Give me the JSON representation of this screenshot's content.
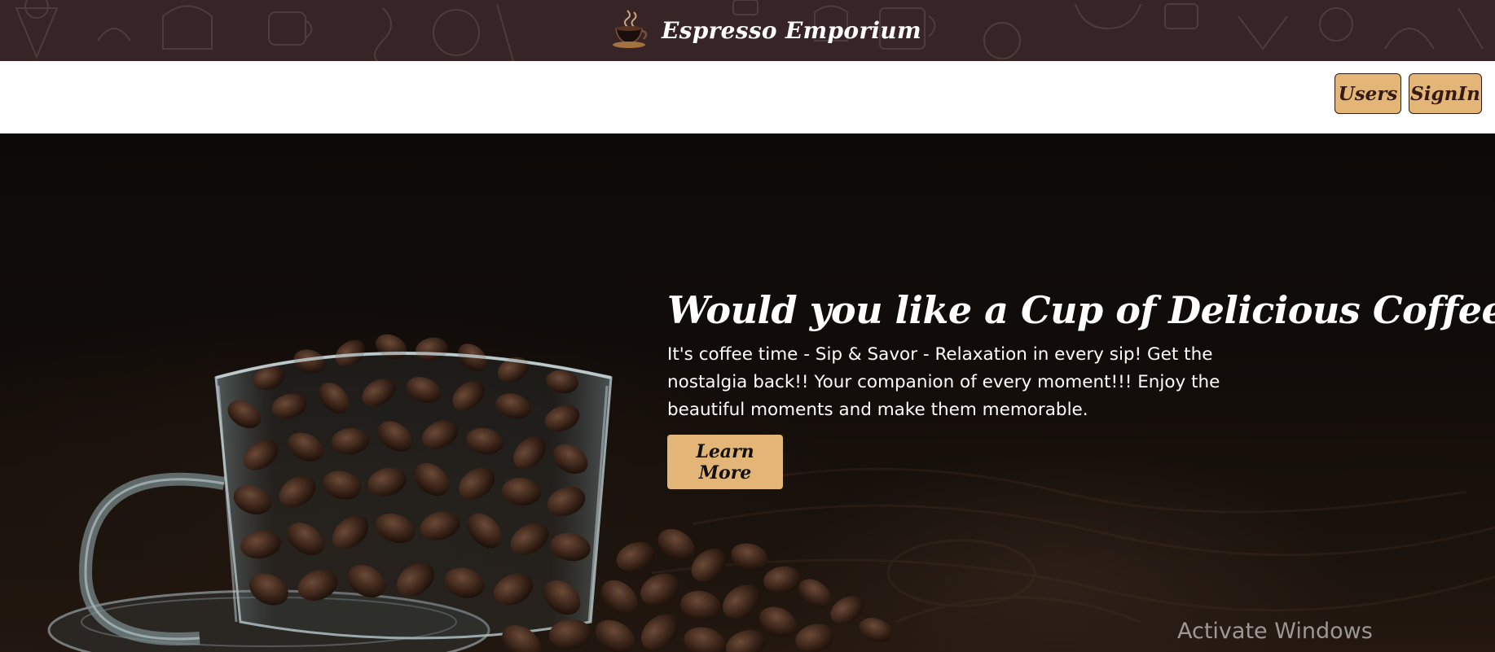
{
  "header": {
    "brand_title": "Espresso Emporium",
    "logo_icon": "coffee-cup-logo-icon",
    "background_color": "#372427"
  },
  "nav": {
    "users_label": "Users",
    "signin_label": "SignIn",
    "button_color": "#e3b577"
  },
  "hero": {
    "title": "Would you like a Cup of Delicious Coffee?",
    "text": "It's coffee time - Sip & Savor - Relaxation in every sip! Get the nostalgia back!! Your companion of every moment!!! Enjoy the beautiful moments and make them memorable.",
    "cta_label": "Learn More",
    "image_subject": "glass-cup-of-coffee-beans"
  },
  "os_overlay": {
    "watermark": "Activate Windows"
  }
}
